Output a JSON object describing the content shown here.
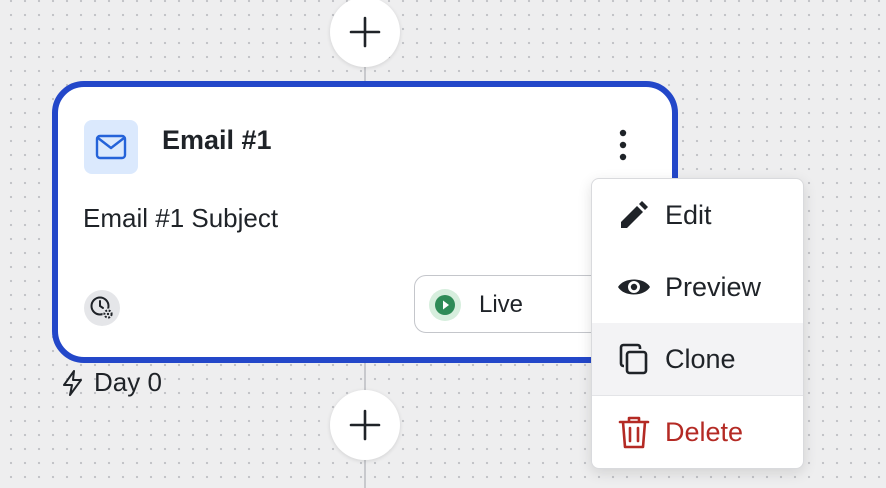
{
  "canvas": {
    "add_step_tooltip": ""
  },
  "card": {
    "title": "Email #1",
    "subject": "Email #1 Subject",
    "status": "Live",
    "status_color": "#2e8b57",
    "border_color": "#2347c9",
    "type_icon": "mail-icon"
  },
  "trigger": {
    "label": "Day 0",
    "icon": "lightning-icon"
  },
  "menu": {
    "items": [
      {
        "label": "Edit",
        "icon": "pencil-icon"
      },
      {
        "label": "Preview",
        "icon": "eye-icon"
      },
      {
        "label": "Clone",
        "icon": "copy-icon"
      },
      {
        "label": "Delete",
        "icon": "trash-icon",
        "color": "#b42a24"
      }
    ],
    "hovered": "Clone"
  }
}
